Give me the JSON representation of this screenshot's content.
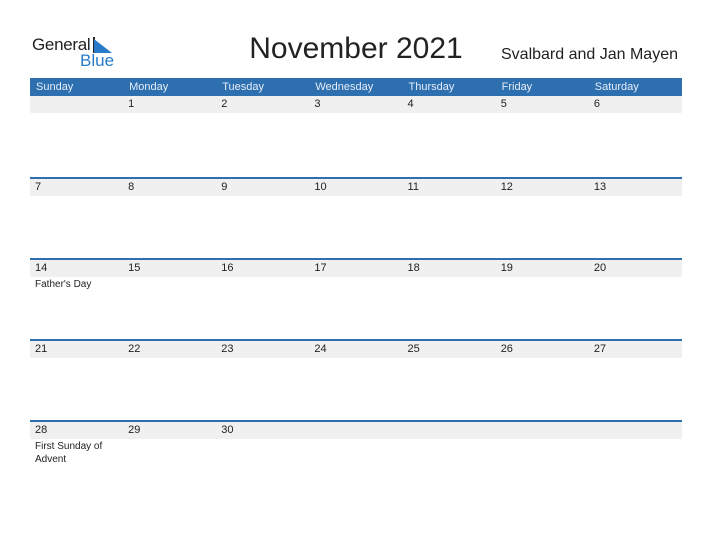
{
  "logo": {
    "general": "General",
    "blue": "Blue"
  },
  "title": "November 2021",
  "region": "Svalbard and Jan Mayen",
  "colors": {
    "header": "#2e6fb0",
    "strip": "#f0f0f0",
    "brand_blue": "#2a7bc7"
  },
  "weekdays": [
    "Sunday",
    "Monday",
    "Tuesday",
    "Wednesday",
    "Thursday",
    "Friday",
    "Saturday"
  ],
  "weeks": [
    [
      {
        "d": ""
      },
      {
        "d": "1"
      },
      {
        "d": "2"
      },
      {
        "d": "3"
      },
      {
        "d": "4"
      },
      {
        "d": "5"
      },
      {
        "d": "6"
      }
    ],
    [
      {
        "d": "7"
      },
      {
        "d": "8"
      },
      {
        "d": "9"
      },
      {
        "d": "10"
      },
      {
        "d": "11"
      },
      {
        "d": "12"
      },
      {
        "d": "13"
      }
    ],
    [
      {
        "d": "14",
        "h": "Father's Day"
      },
      {
        "d": "15"
      },
      {
        "d": "16"
      },
      {
        "d": "17"
      },
      {
        "d": "18"
      },
      {
        "d": "19"
      },
      {
        "d": "20"
      }
    ],
    [
      {
        "d": "21"
      },
      {
        "d": "22"
      },
      {
        "d": "23"
      },
      {
        "d": "24"
      },
      {
        "d": "25"
      },
      {
        "d": "26"
      },
      {
        "d": "27"
      }
    ],
    [
      {
        "d": "28",
        "h": "First Sunday of Advent"
      },
      {
        "d": "29"
      },
      {
        "d": "30"
      },
      {
        "d": ""
      },
      {
        "d": ""
      },
      {
        "d": ""
      },
      {
        "d": ""
      }
    ]
  ]
}
